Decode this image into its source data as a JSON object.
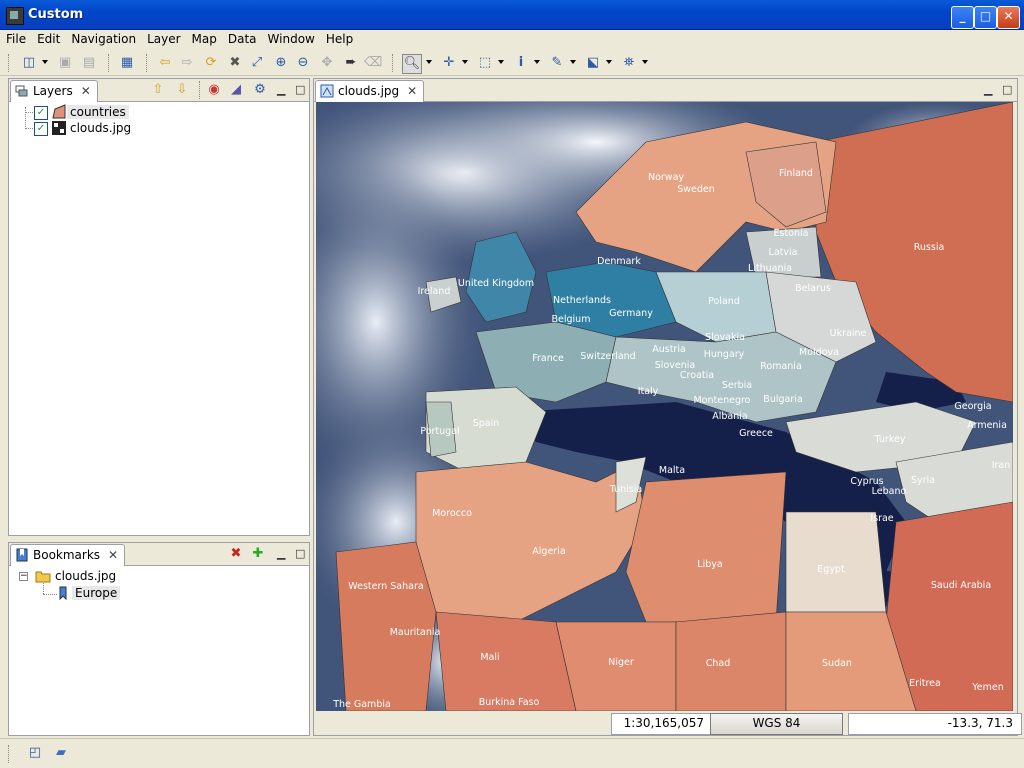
{
  "window": {
    "title": "Custom",
    "minimize": "_",
    "maximize": "□",
    "close": "✕"
  },
  "menu": [
    "File",
    "Edit",
    "Navigation",
    "Layer",
    "Map",
    "Data",
    "Window",
    "Help"
  ],
  "layers_view": {
    "tab_label": "Layers",
    "items": [
      {
        "label": "countries",
        "checked": true
      },
      {
        "label": "clouds.jpg",
        "checked": true
      }
    ]
  },
  "bookmarks_view": {
    "tab_label": "Bookmarks",
    "items": [
      {
        "label": "clouds.jpg"
      },
      {
        "label": "Europe"
      }
    ]
  },
  "editor": {
    "tab_label": "clouds.jpg"
  },
  "map_labels": {
    "norway": "Norway",
    "sweden": "Sweden",
    "finland": "Finland",
    "estonia": "Estonia",
    "latvia": "Latvia",
    "lithuania": "Lithuania",
    "russia": "Russia",
    "denmark": "Denmark",
    "uk": "United Kingdom",
    "ireland": "Ireland",
    "netherlands": "Netherlands",
    "belgium": "Belgium",
    "germany": "Germany",
    "poland": "Poland",
    "belarus": "Belarus",
    "ukraine": "Ukraine",
    "slovakia": "Slovakia",
    "austria": "Austria",
    "hungary": "Hungary",
    "moldova": "Moldova",
    "france": "France",
    "switzerland": "Switzerland",
    "slovenia": "Slovenia",
    "croatia": "Croatia",
    "romania": "Romania",
    "serbia": "Serbia",
    "montenegro": "Montenegro",
    "bulgaria": "Bulgaria",
    "italy": "Italy",
    "albania": "Albania",
    "greece": "Greece",
    "georgia": "Georgia",
    "armenia": "Armenia",
    "turkey": "Turkey",
    "spain": "Spain",
    "portugal": "Portugal",
    "malta": "Malta",
    "tunisia": "Tunisia",
    "morocco": "Morocco",
    "cyprus": "Cyprus",
    "lebanon": "Lebano",
    "syria": "Syria",
    "iran": "Iran",
    "israel": "Israe",
    "algeria": "Algeria",
    "libya": "Libya",
    "egypt": "Egypt",
    "saudi": "Saudi Arabia",
    "western_sahara": "Western Sahara",
    "mauritania": "Mauritania",
    "mali": "Mali",
    "niger": "Niger",
    "chad": "Chad",
    "sudan": "Sudan",
    "eritrea": "Eritrea",
    "yemen": "Yemen",
    "gambia": "The Gambia",
    "burkina": "Burkina Faso"
  },
  "status": {
    "scale": "1:30,165,057",
    "crs": "WGS 84",
    "coords": "-13.3, 71.3"
  },
  "colors": {
    "titlebar": "#0a5ad8",
    "chrome": "#ece9d8",
    "sea": "#15204a"
  }
}
